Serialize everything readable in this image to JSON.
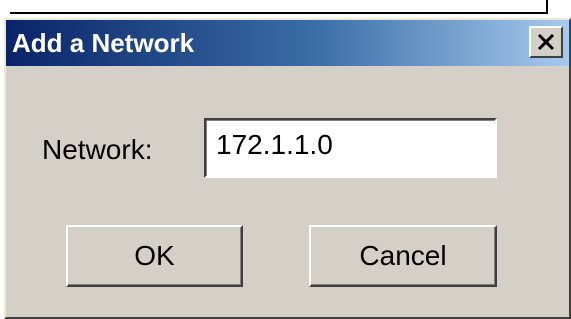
{
  "dialog": {
    "title": "Add a Network",
    "close_icon": "close-icon",
    "network_label": "Network:",
    "network_value": "172.1.1.0",
    "ok_label": "OK",
    "cancel_label": "Cancel"
  },
  "colors": {
    "titlebar_start": "#0a246a",
    "titlebar_end": "#a6caf0",
    "dialog_face": "#d4d0c8"
  }
}
